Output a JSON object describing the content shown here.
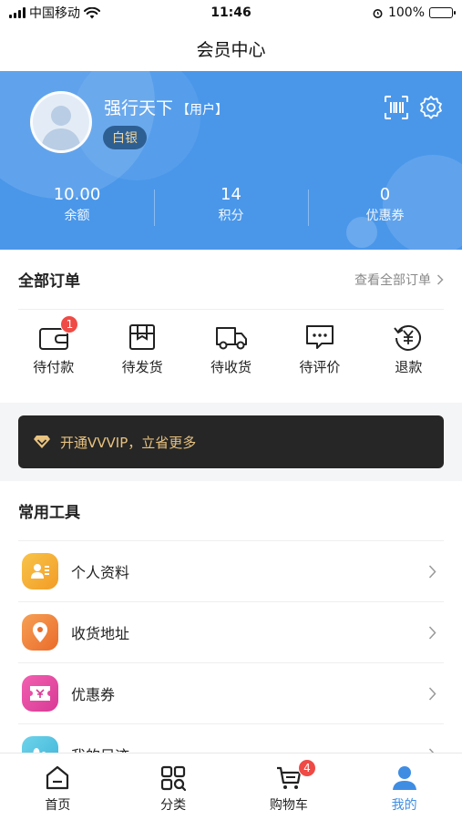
{
  "status_bar": {
    "carrier": "中国移动",
    "time": "11:46",
    "battery": "100%"
  },
  "nav": {
    "title": "会员中心"
  },
  "profile": {
    "name": "强行天下",
    "role": "【用户】",
    "level": "白银",
    "stats": [
      {
        "value": "10.00",
        "label": "余额"
      },
      {
        "value": "14",
        "label": "积分"
      },
      {
        "value": "0",
        "label": "优惠券"
      }
    ]
  },
  "orders": {
    "title": "全部订单",
    "view_all": "查看全部订单",
    "items": [
      {
        "label": "待付款",
        "badge": "1"
      },
      {
        "label": "待发货"
      },
      {
        "label": "待收货"
      },
      {
        "label": "待评价"
      },
      {
        "label": "退款"
      }
    ]
  },
  "vip": {
    "text": "开通VVVIP，立省更多"
  },
  "tools": {
    "title": "常用工具",
    "items": [
      {
        "label": "个人资料"
      },
      {
        "label": "收货地址"
      },
      {
        "label": "优惠券"
      },
      {
        "label": "我的足迹"
      }
    ]
  },
  "tabbar": {
    "items": [
      {
        "label": "首页"
      },
      {
        "label": "分类"
      },
      {
        "label": "购物车",
        "badge": "4"
      },
      {
        "label": "我的"
      }
    ]
  },
  "colors": {
    "brand": "#4a97ea",
    "active_tab": "#3f8de3",
    "badge": "#ef4a45",
    "vip_bg": "#262626",
    "vip_text": "#e8c27f"
  }
}
